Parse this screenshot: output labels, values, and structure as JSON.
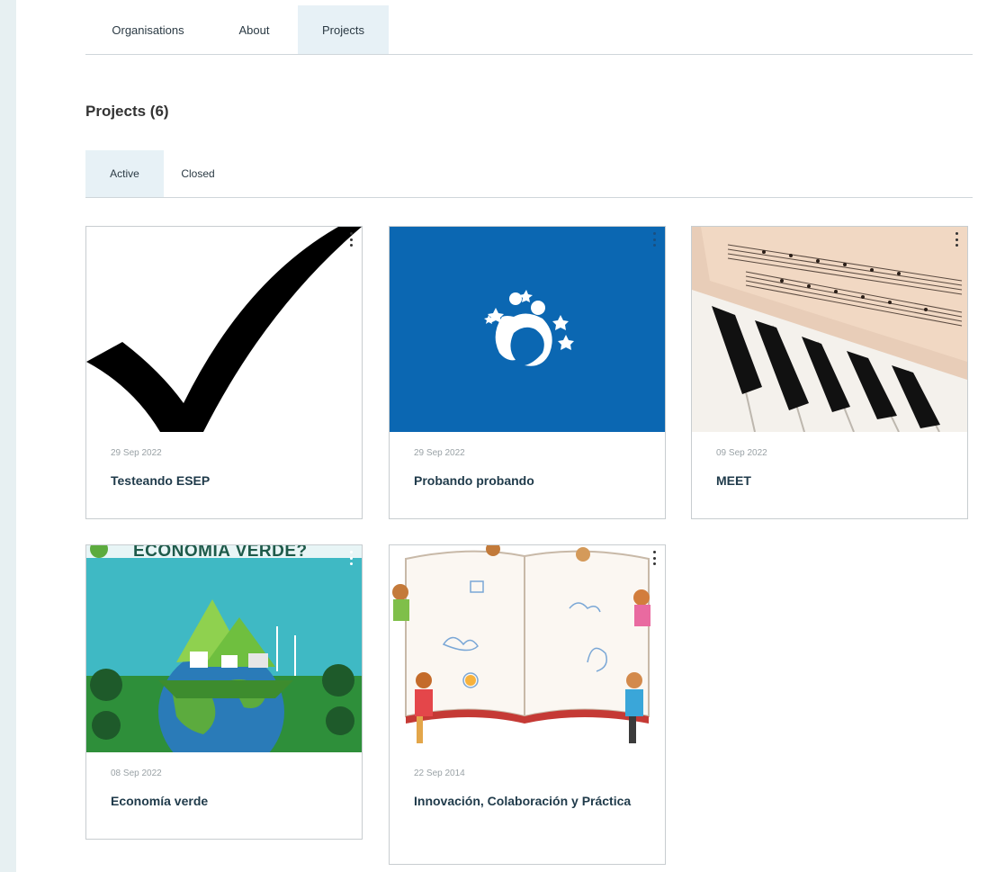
{
  "nav": {
    "tabs": [
      {
        "label": "Organisations"
      },
      {
        "label": "About"
      },
      {
        "label": "Projects"
      }
    ],
    "active_tab": "Projects"
  },
  "projects": {
    "heading": "Projects (6)",
    "filters": [
      {
        "label": "Active"
      },
      {
        "label": "Closed"
      }
    ],
    "active_filter": "Active",
    "cards": [
      {
        "date": "29 Sep 2022",
        "title": "Testeando ESEP",
        "thumbnail": "checkmark-image"
      },
      {
        "date": "29 Sep 2022",
        "title": "Probando probando",
        "thumbnail": "stars-people-logo-image"
      },
      {
        "date": "09 Sep 2022",
        "title": "MEET",
        "thumbnail": "sheet-music-piano-image"
      },
      {
        "date": "08 Sep 2022",
        "title": "Economía verde",
        "thumbnail": "green-economy-infographic-image",
        "thumb_text": "ECONOMÍA VERDE?"
      },
      {
        "date": "22 Sep 2014",
        "title": "Innovación, Colaboración y Práctica",
        "thumbnail": "children-drawing-book-image"
      }
    ]
  },
  "colors": {
    "page_bg": "#e7f0f2",
    "active_tab_bg": "#e7f1f6",
    "title_text": "#1f3a4a",
    "card_blue": "#0b67b2"
  }
}
